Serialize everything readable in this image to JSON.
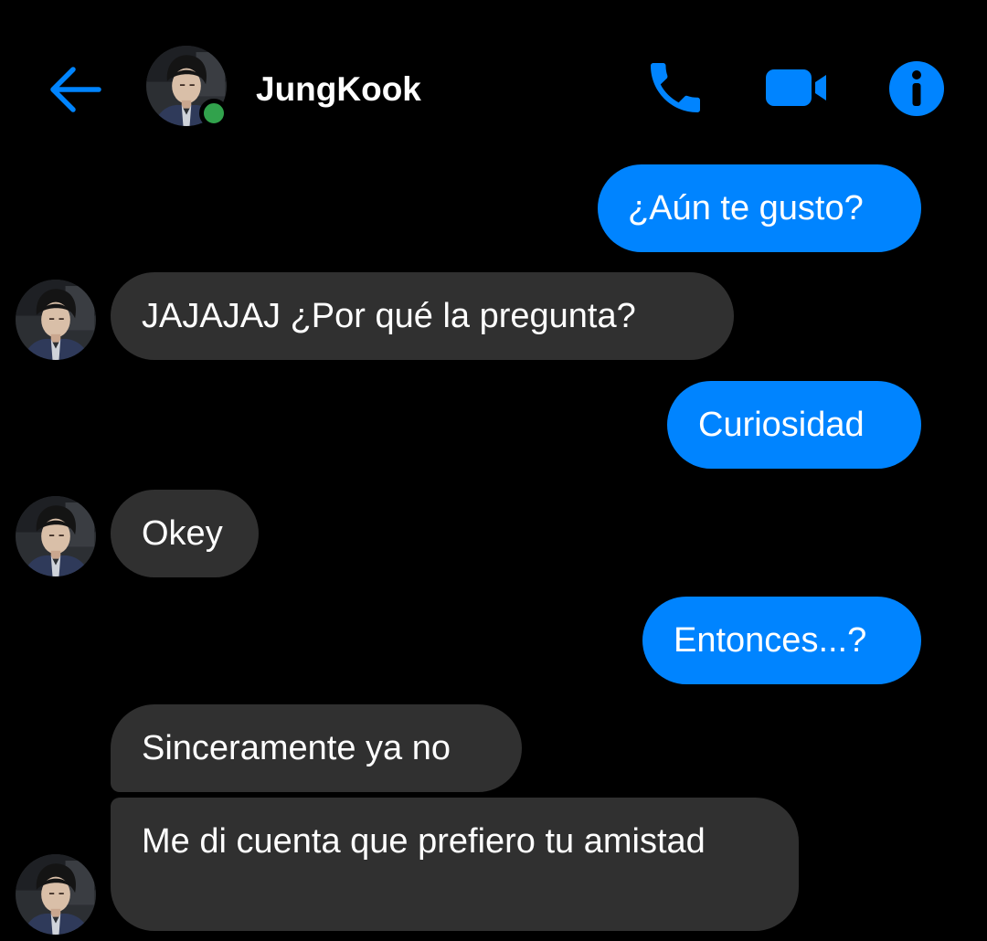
{
  "header": {
    "contact_name": "JungKook",
    "online": true,
    "icons": [
      "back-arrow-icon",
      "phone-icon",
      "video-camera-icon",
      "info-icon"
    ]
  },
  "colors": {
    "background": "#000000",
    "accent": "#0084ff",
    "outgoing_bubble": "#0084ff",
    "incoming_bubble": "#303030",
    "online_indicator": "#31a24c",
    "text": "#ffffff"
  },
  "messages": [
    {
      "direction": "outgoing",
      "text": "¿Aún te gusto?"
    },
    {
      "direction": "incoming",
      "text": "JAJAJAJ ¿Por qué la pregunta?"
    },
    {
      "direction": "outgoing",
      "text": "Curiosidad"
    },
    {
      "direction": "incoming",
      "text": "Okey"
    },
    {
      "direction": "outgoing",
      "text": "Entonces...?"
    },
    {
      "direction": "incoming",
      "text": "Sinceramente ya no"
    },
    {
      "direction": "incoming",
      "text": "Me di cuenta que prefiero tu amistad"
    }
  ]
}
